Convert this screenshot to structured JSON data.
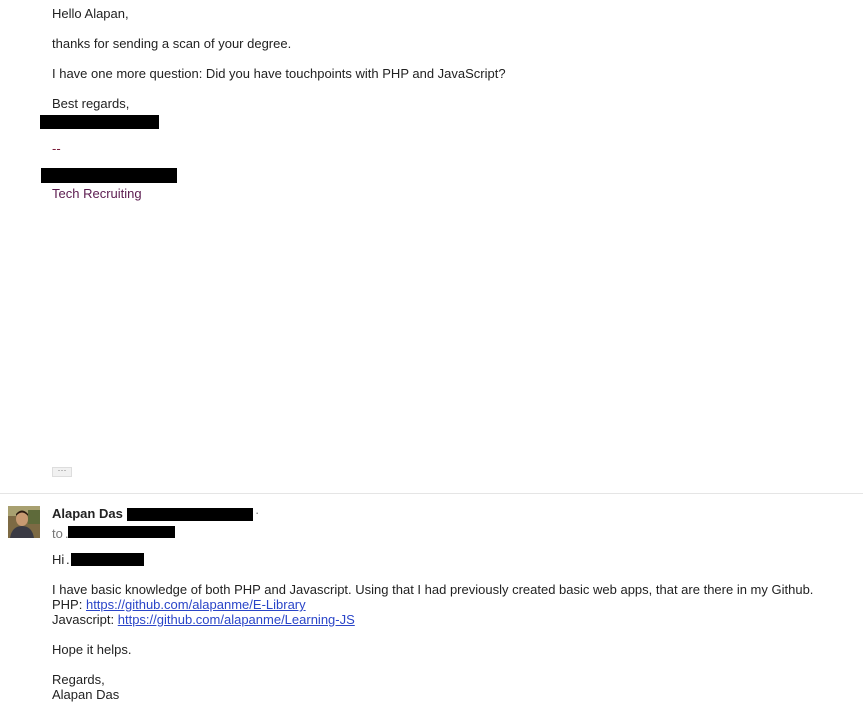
{
  "previous_message": {
    "greeting": "Hello Alapan,",
    "line1": "thanks for sending a scan of your degree.",
    "line2": "I have one more question: Did you have touchpoints with PHP and JavaScript?",
    "closing": "Best regards,",
    "signature_separator": "--",
    "signature_department": "Tech Recruiting",
    "show_trimmed_label": "···"
  },
  "reply_message": {
    "sender_name": "Alapan Das",
    "to_label": "to",
    "greeting_prefix": "Hi",
    "body_line1": "I have basic knowledge of both PHP and Javascript. Using that I had previously created basic web apps, that are there in my Github.",
    "php_label": "PHP: ",
    "php_link": "https://github.com/alapanme/E-Library",
    "js_label": "Javascript: ",
    "js_link": "https://github.com/alapanme/Learning-JS",
    "hope": "Hope it helps.",
    "regards": "Regards,",
    "signature_name": "Alapan Das"
  },
  "colors": {
    "link": "#2a45c8",
    "redaction": "#000000",
    "signature_department": "#5b1b4f"
  },
  "icons": {
    "avatar": "sender-avatar-photo"
  }
}
